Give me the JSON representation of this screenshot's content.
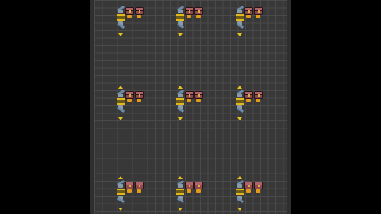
{
  "scene": {
    "background": "#000000",
    "viewport_color": "#2f2f2f",
    "grid_color": "#4a4a4a",
    "belt_color": "#e0b81c",
    "chest_color": "#8e4a4f",
    "inserter_color": "#6d8aa6"
  },
  "entities": {
    "rows": 3,
    "columns": 3,
    "per_cluster": [
      "inserter-icon",
      "transport-belt-icon",
      "inserter-icon",
      "wooden-chest-icon",
      "wooden-chest-icon"
    ]
  }
}
